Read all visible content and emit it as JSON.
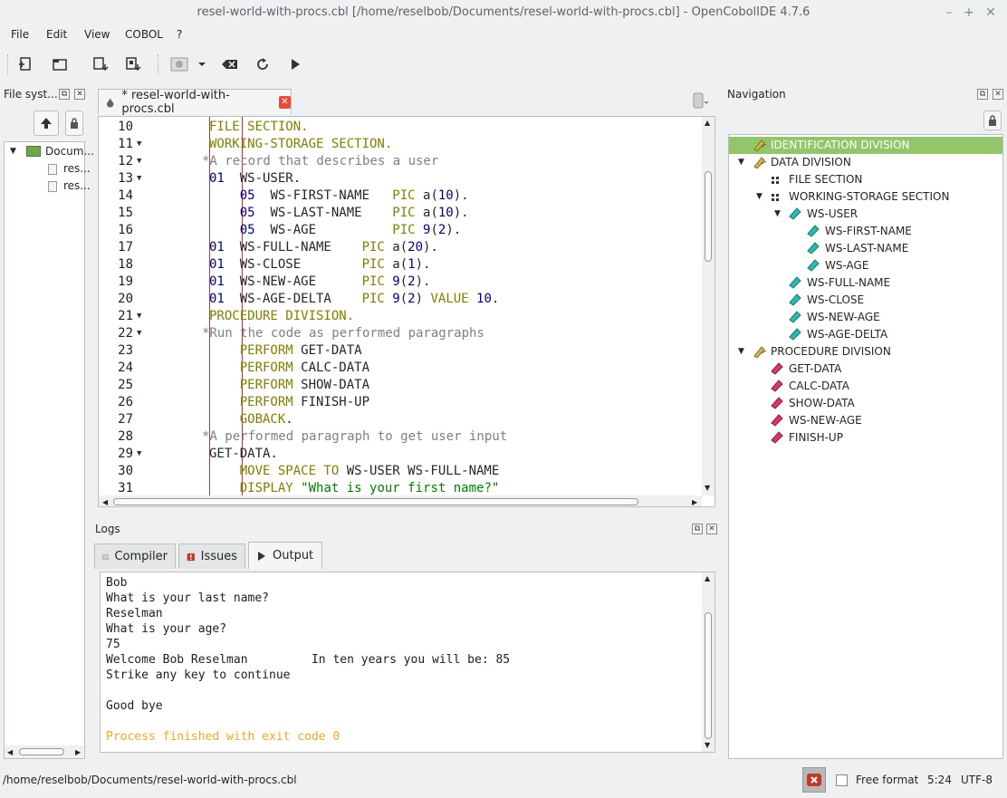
{
  "window": {
    "title": "resel-world-with-procs.cbl [/home/reselbob/Documents/resel-world-with-procs.cbl] - OpenCobolIDE 4.7.6",
    "min_icon": "minimize-icon",
    "max_icon": "maximize-icon",
    "close_icon": "close-icon"
  },
  "menu": [
    "File",
    "Edit",
    "View",
    "COBOL",
    "?"
  ],
  "toolbar": {
    "icons": [
      "new-file-icon",
      "open-file-icon",
      "save-icon",
      "save-as-icon",
      "compile-icon",
      "dropdown-icon",
      "clean-icon",
      "rebuild-icon",
      "run-icon"
    ]
  },
  "filesystem": {
    "title": "File syst...",
    "root": "Docum...",
    "files": [
      "res...",
      "res..."
    ]
  },
  "editor": {
    "tab_label": "* resel-world-with-procs.cbl",
    "lines": [
      {
        "n": "10",
        "fold": "",
        "segs": [
          [
            "FILE ",
            "kw"
          ],
          [
            "SECTION.",
            "kw"
          ]
        ]
      },
      {
        "n": "11",
        "fold": "▼",
        "segs": [
          [
            "WORKING-STORAGE SECTION.",
            "kw"
          ]
        ]
      },
      {
        "n": "12",
        "fold": "▼",
        "segs": [
          [
            "*A record that describes a user",
            "cmt"
          ]
        ]
      },
      {
        "n": "13",
        "fold": "▼",
        "segs": [
          [
            "01  ",
            "num"
          ],
          [
            "WS-USER.",
            ""
          ]
        ]
      },
      {
        "n": "14",
        "fold": "",
        "segs": [
          [
            "    05  ",
            "num"
          ],
          [
            "WS-FIRST-NAME   ",
            ""
          ],
          [
            "PIC ",
            "kw"
          ],
          [
            "a(",
            ""
          ],
          [
            "10",
            "num"
          ],
          [
            ").",
            ""
          ]
        ]
      },
      {
        "n": "15",
        "fold": "",
        "segs": [
          [
            "    05  ",
            "num"
          ],
          [
            "WS-LAST-NAME    ",
            ""
          ],
          [
            "PIC ",
            "kw"
          ],
          [
            "a(",
            ""
          ],
          [
            "10",
            "num"
          ],
          [
            ").",
            ""
          ]
        ]
      },
      {
        "n": "16",
        "fold": "",
        "segs": [
          [
            "    05  ",
            "num"
          ],
          [
            "WS-AGE          ",
            ""
          ],
          [
            "PIC ",
            "kw"
          ],
          [
            "9",
            "num"
          ],
          [
            "(",
            ""
          ],
          [
            "2",
            "num"
          ],
          [
            ").",
            ""
          ]
        ]
      },
      {
        "n": "17",
        "fold": "",
        "segs": [
          [
            "01  ",
            "num"
          ],
          [
            "WS-FULL-NAME    ",
            ""
          ],
          [
            "PIC ",
            "kw"
          ],
          [
            "a(",
            ""
          ],
          [
            "20",
            "num"
          ],
          [
            ").",
            ""
          ]
        ]
      },
      {
        "n": "18",
        "fold": "",
        "segs": [
          [
            "01  ",
            "num"
          ],
          [
            "WS-CLOSE        ",
            ""
          ],
          [
            "PIC ",
            "kw"
          ],
          [
            "a(",
            ""
          ],
          [
            "1",
            "num"
          ],
          [
            ").",
            ""
          ]
        ]
      },
      {
        "n": "19",
        "fold": "",
        "segs": [
          [
            "01  ",
            "num"
          ],
          [
            "WS-NEW-AGE      ",
            ""
          ],
          [
            "PIC ",
            "kw"
          ],
          [
            "9",
            "num"
          ],
          [
            "(",
            ""
          ],
          [
            "2",
            "num"
          ],
          [
            ").",
            ""
          ]
        ]
      },
      {
        "n": "20",
        "fold": "",
        "segs": [
          [
            "01  ",
            "num"
          ],
          [
            "WS-AGE-DELTA    ",
            ""
          ],
          [
            "PIC ",
            "kw"
          ],
          [
            "9",
            "num"
          ],
          [
            "(",
            ""
          ],
          [
            "2",
            "num"
          ],
          [
            ") ",
            ""
          ],
          [
            "VALUE ",
            "kw"
          ],
          [
            "10",
            "num"
          ],
          [
            ".",
            ""
          ]
        ]
      },
      {
        "n": "21",
        "fold": "▼",
        "segs": [
          [
            "PROCEDURE DIVISION.",
            "kw"
          ]
        ]
      },
      {
        "n": "22",
        "fold": "▼",
        "segs": [
          [
            "*Run the code as performed paragraphs",
            "cmt"
          ]
        ]
      },
      {
        "n": "23",
        "fold": "",
        "segs": [
          [
            "    PERFORM ",
            "kw"
          ],
          [
            "GET-DATA",
            ""
          ]
        ]
      },
      {
        "n": "24",
        "fold": "",
        "segs": [
          [
            "    PERFORM ",
            "kw"
          ],
          [
            "CALC-DATA",
            ""
          ]
        ]
      },
      {
        "n": "25",
        "fold": "",
        "segs": [
          [
            "    PERFORM ",
            "kw"
          ],
          [
            "SHOW-DATA",
            ""
          ]
        ]
      },
      {
        "n": "26",
        "fold": "",
        "segs": [
          [
            "    PERFORM ",
            "kw"
          ],
          [
            "FINISH-UP",
            ""
          ]
        ]
      },
      {
        "n": "27",
        "fold": "",
        "segs": [
          [
            "    GOBACK",
            "kw"
          ],
          [
            ".",
            ""
          ]
        ]
      },
      {
        "n": "28",
        "fold": "",
        "segs": [
          [
            "*A performed paragraph to get user input",
            "cmt"
          ]
        ]
      },
      {
        "n": "29",
        "fold": "▼",
        "segs": [
          [
            "GET-DATA.",
            ""
          ]
        ]
      },
      {
        "n": "30",
        "fold": "",
        "segs": [
          [
            "    MOVE SPACE TO ",
            "kw"
          ],
          [
            "WS-USER WS-FULL-NAME",
            ""
          ]
        ]
      },
      {
        "n": "31",
        "fold": "",
        "segs": [
          [
            "    DISPLAY ",
            "kw"
          ],
          [
            "\"What is your first name?\"",
            "str"
          ]
        ]
      }
    ]
  },
  "logs": {
    "title": "Logs",
    "tabs": [
      "Compiler",
      "Issues",
      "Output"
    ],
    "output_lines": [
      "Bob",
      "What is your last name?",
      "Reselman",
      "What is your age?",
      "75",
      "Welcome Bob Reselman         In ten years you will be: 85",
      "Strike any key to continue",
      "",
      "Good bye",
      "",
      "Process finished with exit code 0"
    ]
  },
  "navigation": {
    "title": "Navigation",
    "items": [
      {
        "label": "IDENTIFICATION DIVISION",
        "level": 0,
        "icon": "division",
        "expander": "",
        "selected": true
      },
      {
        "label": "DATA DIVISION",
        "level": 0,
        "icon": "division",
        "expander": "▼"
      },
      {
        "label": "FILE SECTION",
        "level": 1,
        "icon": "section",
        "expander": ""
      },
      {
        "label": "WORKING-STORAGE SECTION",
        "level": 1,
        "icon": "section",
        "expander": "▼"
      },
      {
        "label": "WS-USER",
        "level": 2,
        "icon": "var",
        "expander": "▼"
      },
      {
        "label": "WS-FIRST-NAME",
        "level": 3,
        "icon": "var",
        "expander": ""
      },
      {
        "label": "WS-LAST-NAME",
        "level": 3,
        "icon": "var",
        "expander": ""
      },
      {
        "label": "WS-AGE",
        "level": 3,
        "icon": "var",
        "expander": ""
      },
      {
        "label": "WS-FULL-NAME",
        "level": 2,
        "icon": "var",
        "expander": ""
      },
      {
        "label": "WS-CLOSE",
        "level": 2,
        "icon": "var",
        "expander": ""
      },
      {
        "label": "WS-NEW-AGE",
        "level": 2,
        "icon": "var",
        "expander": ""
      },
      {
        "label": "WS-AGE-DELTA",
        "level": 2,
        "icon": "var",
        "expander": ""
      },
      {
        "label": "PROCEDURE DIVISION",
        "level": 0,
        "icon": "division",
        "expander": "▼"
      },
      {
        "label": "GET-DATA",
        "level": 1,
        "icon": "proc",
        "expander": ""
      },
      {
        "label": "CALC-DATA",
        "level": 1,
        "icon": "proc",
        "expander": ""
      },
      {
        "label": "SHOW-DATA",
        "level": 1,
        "icon": "proc",
        "expander": ""
      },
      {
        "label": "WS-NEW-AGE",
        "level": 1,
        "icon": "proc",
        "expander": ""
      },
      {
        "label": "FINISH-UP",
        "level": 1,
        "icon": "proc",
        "expander": ""
      }
    ]
  },
  "statusbar": {
    "path": "/home/reselbob/Documents/resel-world-with-procs.cbl",
    "free_format_label": "Free format",
    "cursor": "5:24",
    "encoding": "UTF-8"
  },
  "colors": {
    "keyword": "#808000",
    "number": "#000080",
    "comment": "#808080",
    "string": "#008000",
    "selected_nav": "#93c56a",
    "exit_text": "#f5a623"
  }
}
